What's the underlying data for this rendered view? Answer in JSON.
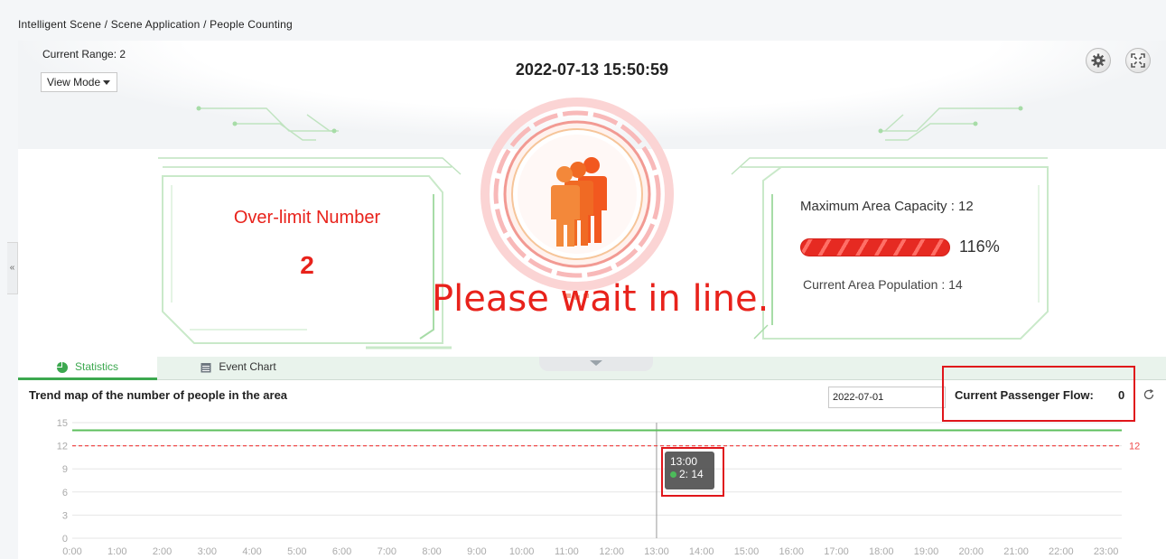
{
  "breadcrumb": "Intelligent Scene / Scene Application / People Counting",
  "header": {
    "current_range": "Current Range: 2",
    "view_mode": "View Mode",
    "datetime": "2022-07-13 15:50:59",
    "settings_icon": "gear-icon",
    "fullscreen_icon": "fullscreen-icon"
  },
  "left_card": {
    "title": "Over-limit Number",
    "value": "2"
  },
  "right_card": {
    "capacity_label": "Maximum Area Capacity : 12",
    "percent_text": "116%",
    "percent_value": 116,
    "population_label": "Current Area Population : 14"
  },
  "notice": "Please wait in line.",
  "tabs": [
    {
      "label": "Statistics",
      "icon": "pie-chart-icon",
      "active": true
    },
    {
      "label": "Event Chart",
      "icon": "calendar-icon",
      "active": false
    }
  ],
  "chart_panel": {
    "title": "Trend map of the number of people in the area",
    "date": "2022-07-01",
    "flow_label": "Current Passenger Flow:",
    "flow_value": "0"
  },
  "tooltip": {
    "time": "13:00",
    "entry": "2: 14"
  },
  "colors": {
    "accent_green": "#3ca84f",
    "alert_red": "#e8221b",
    "limit_line": "#ef4b4b"
  },
  "chart_data": {
    "type": "line",
    "x": [
      "0:00",
      "1:00",
      "2:00",
      "3:00",
      "4:00",
      "5:00",
      "6:00",
      "7:00",
      "8:00",
      "9:00",
      "10:00",
      "11:00",
      "12:00",
      "13:00",
      "14:00",
      "15:00",
      "16:00",
      "17:00",
      "18:00",
      "19:00",
      "20:00",
      "21:00",
      "22:00",
      "23:00"
    ],
    "series": [
      {
        "name": "2",
        "values": [
          14,
          14,
          14,
          14,
          14,
          14,
          14,
          14,
          14,
          14,
          14,
          14,
          14,
          14,
          14,
          14,
          14,
          14,
          14,
          14,
          14,
          14,
          14,
          14
        ],
        "color": "#5cbf5c"
      }
    ],
    "threshold": {
      "value": 12,
      "label": "12",
      "color": "#ef4b4b"
    },
    "ylim": [
      0,
      15
    ],
    "yticks": [
      "0",
      "3",
      "6",
      "9",
      "12",
      "15"
    ],
    "cursor_x": "13:00",
    "grid": true
  }
}
